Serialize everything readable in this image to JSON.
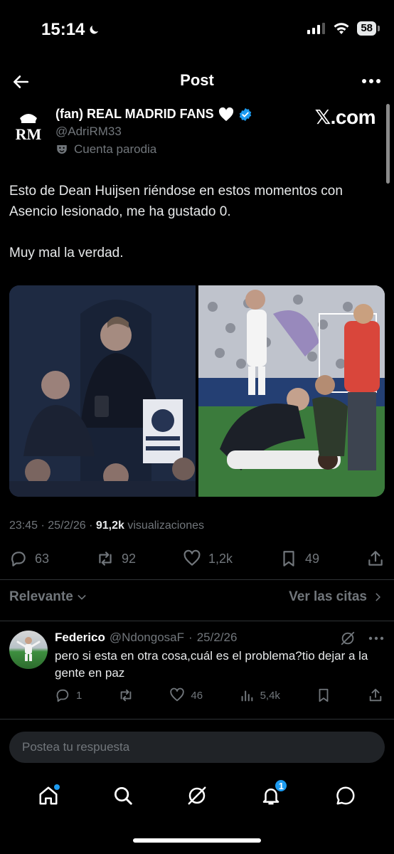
{
  "status": {
    "time": "15:14",
    "battery": "58"
  },
  "header": {
    "title": "Post"
  },
  "author": {
    "name": "(fan) REAL MADRID FANS",
    "handle": "@AdriRM33",
    "parody_label": "Cuenta parodia",
    "logo_text": "RM"
  },
  "watermark": "𝕏.com",
  "post": {
    "paragraph_1": "Esto de Dean Huijsen riéndose en estos momentos con Asencio lesionado, me ha gustado 0.",
    "paragraph_2": "Muy mal la verdad."
  },
  "meta": {
    "time": "23:45",
    "date": "25/2/26",
    "views_count": "91,2k",
    "views_label": "visualizaciones"
  },
  "actions": {
    "replies": "63",
    "reposts": "92",
    "likes": "1,2k",
    "bookmarks": "49"
  },
  "sort": {
    "label": "Relevante",
    "quotes_link": "Ver las citas"
  },
  "reply": {
    "name": "Federico",
    "handle": "@NdongosaF",
    "date": "25/2/26",
    "text": "pero si esta en otra cosa,cuál es el problema?tio dejar a la gente en paz",
    "replies": "1",
    "likes": "46",
    "views": "5,4k"
  },
  "composer": {
    "placeholder": "Postea tu respuesta"
  },
  "nav": {
    "notifications_badge": "1"
  },
  "colors": {
    "accent": "#1d9bf0",
    "muted": "#71767b",
    "text": "#e7e9ea",
    "background": "#000000"
  }
}
